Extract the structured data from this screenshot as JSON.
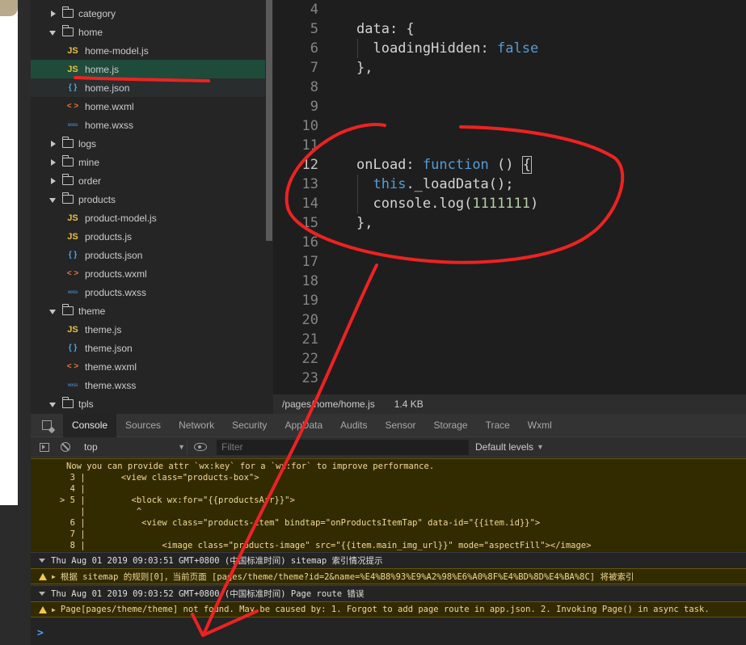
{
  "file_tree": {
    "items": [
      {
        "label": "category",
        "type": "folder",
        "state": "closed",
        "level": 1
      },
      {
        "label": "home",
        "type": "folder",
        "state": "open",
        "level": 1
      },
      {
        "label": "home-model.js",
        "type": "js",
        "level": 2
      },
      {
        "label": "home.js",
        "type": "js",
        "level": 2,
        "selected": true
      },
      {
        "label": "home.json",
        "type": "json",
        "level": 2
      },
      {
        "label": "home.wxml",
        "type": "wxml",
        "level": 2
      },
      {
        "label": "home.wxss",
        "type": "wxss",
        "level": 2
      },
      {
        "label": "logs",
        "type": "folder",
        "state": "closed",
        "level": 1
      },
      {
        "label": "mine",
        "type": "folder",
        "state": "closed",
        "level": 1
      },
      {
        "label": "order",
        "type": "folder",
        "state": "closed",
        "level": 1
      },
      {
        "label": "products",
        "type": "folder",
        "state": "open",
        "level": 1
      },
      {
        "label": "product-model.js",
        "type": "js",
        "level": 2
      },
      {
        "label": "products.js",
        "type": "js",
        "level": 2
      },
      {
        "label": "products.json",
        "type": "json",
        "level": 2
      },
      {
        "label": "products.wxml",
        "type": "wxml",
        "level": 2
      },
      {
        "label": "products.wxss",
        "type": "wxss",
        "level": 2
      },
      {
        "label": "theme",
        "type": "folder",
        "state": "open",
        "level": 1
      },
      {
        "label": "theme.js",
        "type": "js",
        "level": 2
      },
      {
        "label": "theme.json",
        "type": "json",
        "level": 2
      },
      {
        "label": "theme.wxml",
        "type": "wxml",
        "level": 2
      },
      {
        "label": "theme.wxss",
        "type": "wxss",
        "level": 2
      },
      {
        "label": "tpls",
        "type": "folder",
        "state": "open",
        "level": 1
      }
    ],
    "icon_glyphs": {
      "js": "JS",
      "json": "{ }",
      "wxml": "< >",
      "wxss": "wxss"
    }
  },
  "editor": {
    "line_numbers": [
      "4",
      "5",
      "6",
      "7",
      "8",
      "9",
      "10",
      "11",
      "12",
      "13",
      "14",
      "15",
      "16",
      "17",
      "18",
      "19",
      "20",
      "21",
      "22",
      "23"
    ],
    "active_line": "12",
    "code": {
      "l5": {
        "key": "data",
        "punc": ": {"
      },
      "l6": {
        "key": "loadingHidden",
        "punc": ": ",
        "val": "false"
      },
      "l7": {
        "punc": "},"
      },
      "l12": {
        "key": "onLoad",
        "punc": ": ",
        "kw": "function",
        "rest": " () ",
        "brace": "{"
      },
      "l13": {
        "kw": "this",
        "rest": "._loadData();"
      },
      "l14": {
        "fn": "console",
        "rest": ".log(",
        "num": "1111111",
        "close": ")"
      },
      "l15": {
        "punc": "},"
      }
    },
    "status_path": "/pages/home/home.js",
    "status_size": "1.4 KB"
  },
  "devtools": {
    "tabs": [
      "Console",
      "Sources",
      "Network",
      "Security",
      "AppData",
      "Audits",
      "Sensor",
      "Storage",
      "Trace",
      "Wxml"
    ],
    "active_tab": "Console",
    "context": "top",
    "filter_placeholder": "Filter",
    "levels_label": "Default levels",
    "log": {
      "perf_hint": "Now you can provide attr `wx:key` for a `wx:for` to improve performance.",
      "snippet": [
        {
          "marker": "",
          "num": "3",
          "code": "    <view class=\"products-box\">"
        },
        {
          "marker": "",
          "num": "4",
          "code": ""
        },
        {
          "marker": ">",
          "num": "5",
          "code": "      <block wx:for=\"{{productsArr}}\">"
        },
        {
          "marker": "",
          "num": "",
          "code": "       ^"
        },
        {
          "marker": "",
          "num": "6",
          "code": "        <view class=\"products-item\" bindtap=\"onProductsItemTap\" data-id=\"{{item.id}}\">"
        },
        {
          "marker": "",
          "num": "7",
          "code": ""
        },
        {
          "marker": "",
          "num": "8",
          "code": "            <image class=\"products-image\" src=\"{{item.main_img_url}}\" mode=\"aspectFill\"></image>"
        }
      ],
      "group1": "Thu Aug 01 2019 09:03:51 GMT+0800 (中国标准时间) sitemap 索引情况提示",
      "warn1": "根据 sitemap 的规则[0]，当前页面 [pages/theme/theme?id=2&name=%E4%B8%93%E9%A2%98%E6%A0%8F%E4%BD%8D%E4%BA%8C] 将被索引",
      "group2": "Thu Aug 01 2019 09:03:52 GMT+0800 (中国标准时间) Page route 错误",
      "warn2": "Page[pages/theme/theme] not found. May be caused by: 1. Forgot to add page route in app.json. 2. Invoking Page() in async task.",
      "prompt": ">"
    }
  },
  "colors": {
    "annotation": "#ee2222",
    "selection": "#1f4b3b",
    "warning_bg": "#332b00"
  }
}
